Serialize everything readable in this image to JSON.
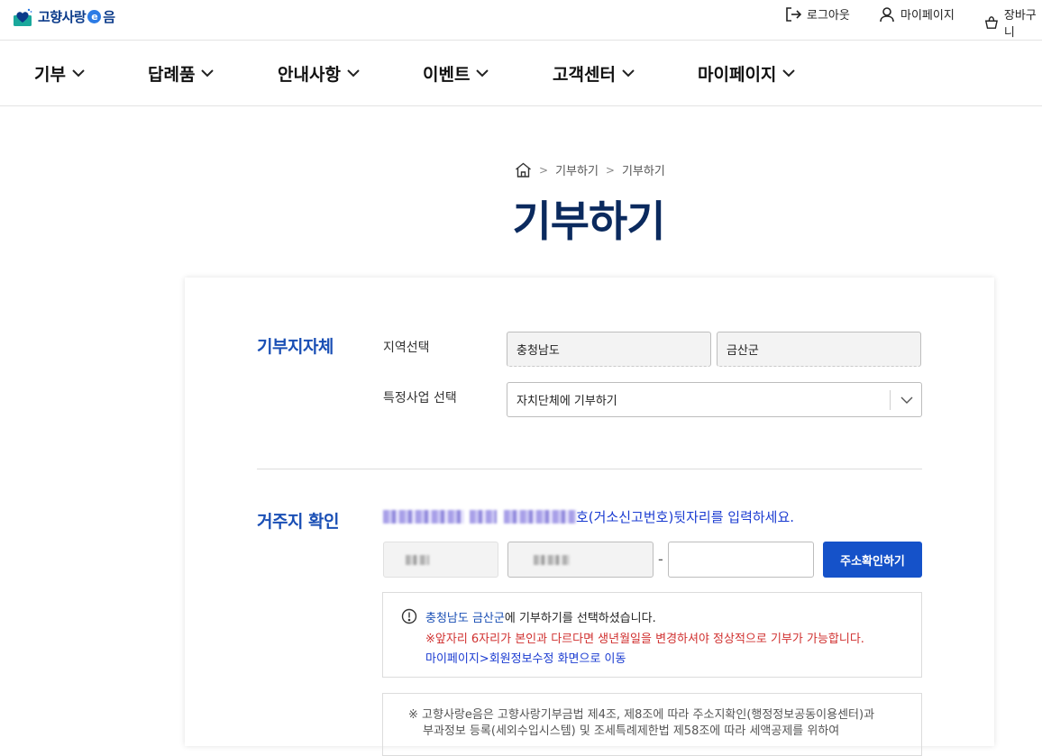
{
  "header": {
    "logo_text_1": "고향사랑",
    "logo_e": "e",
    "logo_text_2": "음",
    "logout_label": "로그아웃",
    "mypage_label": "마이페이지",
    "cart_label": "장바구니",
    "icons": {
      "logout": "logout-icon",
      "user": "user-icon",
      "cart": "cart-icon"
    }
  },
  "nav": {
    "items": [
      {
        "label": "기부"
      },
      {
        "label": "답례품"
      },
      {
        "label": "안내사항"
      },
      {
        "label": "이벤트"
      },
      {
        "label": "고객센터"
      },
      {
        "label": "마이페이지"
      }
    ]
  },
  "breadcrumb": {
    "home_icon": "home-icon",
    "items": [
      "기부하기",
      "기부하기"
    ]
  },
  "page_title": "기부하기",
  "donation_region": {
    "section_title": "기부지자체",
    "region_label": "지역선택",
    "province_value": "충청남도",
    "district_value": "금산군",
    "project_label": "특정사업 선택",
    "project_value": "자치단체에 기부하기"
  },
  "residence": {
    "section_title": "거주지 확인",
    "instruction_suffix": "호(거소신고번호)뒷자리를 입력하세요.",
    "separator": "-",
    "verify_button": "주소확인하기"
  },
  "info": {
    "region_highlight": "충청남도 금산군",
    "selected_text": "에 기부하기를 선택하셨습니다.",
    "warning_text": "※앞자리 6자리가 본인과 다르다면 생년월일을 변경하셔야 정상적으로 기부가 가능합니다.",
    "link_text": "마이페이지>회원정보수정 화면으로 이동"
  },
  "notice": {
    "line1": "※ 고향사랑e음은 고향사랑기부금법 제4조, 제8조에 따라 주소지확인(행정정보공동이용센터)과",
    "line2": "부과정보 등록(세외수입시스템) 및 조세특례제한법 제58조에 따라 세액공제를 위하여"
  },
  "colors": {
    "brand": "#0b2a5e",
    "accent": "#1552c9",
    "section": "#1a4fb5",
    "warning": "#d0302f",
    "link": "#1a3bd1"
  }
}
